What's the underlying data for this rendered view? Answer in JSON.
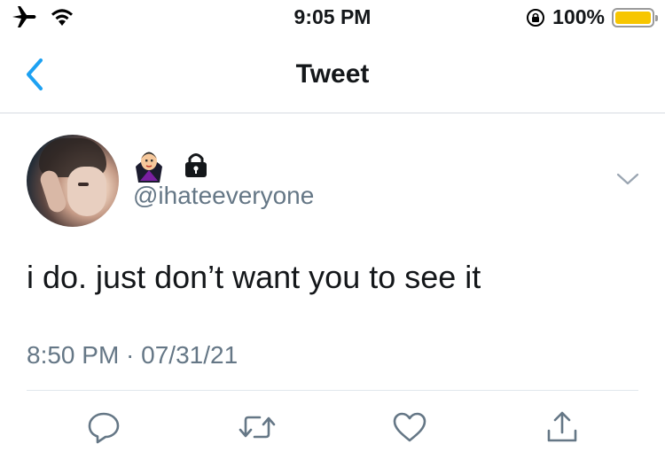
{
  "status_bar": {
    "time": "9:05 PM",
    "battery_percent_label": "100%",
    "battery_level": 1.0,
    "icons": [
      "airplane-icon",
      "wifi-icon",
      "orientation-lock-icon",
      "battery-icon"
    ]
  },
  "nav": {
    "title": "Tweet",
    "back_icon": "chevron-left-icon"
  },
  "tweet": {
    "display_name_emoji": [
      "vampire-icon",
      "lock-icon"
    ],
    "handle": "@ihateeveryone",
    "text": "i do. just don’t want you to see it",
    "timestamp": "8:50 PM · 07/31/21"
  },
  "actions": [
    "reply-icon",
    "retweet-icon",
    "like-icon",
    "share-icon"
  ],
  "colors": {
    "accent": "#1da1f2",
    "secondary_text": "#657786",
    "icon_gray": "#657786",
    "battery": "#f7c600"
  }
}
